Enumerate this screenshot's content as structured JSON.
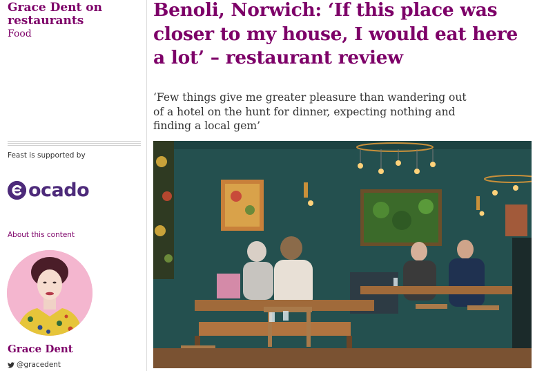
{
  "sidebar": {
    "series_title": "Grace Dent on restaurants",
    "section": "Food",
    "sponsor_label": "Feast is supported by",
    "sponsor_logo": "ocado",
    "about_link": "About this content",
    "author_name": "Grace Dent",
    "author_handle": "@gracedent",
    "twitter_icon": "twitter-icon"
  },
  "article": {
    "headline": "Benoli, Norwich: ‘If this place was closer to my house, I would eat here a lot’ – restaurant review",
    "standfirst": "‘Few things give me greater pleasure than wandering out of a hotel on the hunt for dinner, expecting nothing and finding a local gem’"
  },
  "colors": {
    "accent": "#7d0068",
    "ocado": "#4d2a7a",
    "avatar_bg": "#f4b6cf",
    "wall": "#24504f"
  }
}
